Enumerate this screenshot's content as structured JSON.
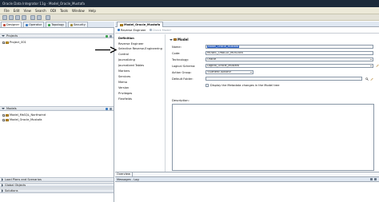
{
  "window": {
    "title": "Oracle Data Integrator 11g - Model_Oracle_Mustafa"
  },
  "menubar": {
    "items": [
      "File",
      "Edit",
      "View",
      "Search",
      "ODI",
      "Tools",
      "Window",
      "Help"
    ]
  },
  "left_tabs": [
    {
      "label": "Designer",
      "active": true
    },
    {
      "label": "Operator",
      "active": false
    },
    {
      "label": "Topology",
      "active": false
    },
    {
      "label": "Security",
      "active": false
    }
  ],
  "projects": {
    "title": "Projects",
    "items": [
      "Project_001"
    ]
  },
  "models": {
    "title": "Models",
    "items": [
      "Model_MsSQL_Northwind",
      "Model_Oracle_Mustafa"
    ]
  },
  "bottom_sections": [
    "Load Plans and Scenarios",
    "Global Objects",
    "Solutions"
  ],
  "editor": {
    "tab_label": "Model_Oracle_Mustafa",
    "toolbar": {
      "reverse": "Reverse Engineer",
      "check_model": "Check Model"
    },
    "nav_items": [
      "Definition",
      "Reverse Engineer",
      "Selective Reverse-Engineering",
      "Control",
      "Journalizing",
      "Journalized Tables",
      "Markers",
      "Services",
      "Memo",
      "Version",
      "Privileges",
      "Flexfields"
    ],
    "nav_selected": 0,
    "section_title": "Model",
    "fields": {
      "name_label": "Name:",
      "name_value": "Model_Oracle_Mustafa",
      "code_label": "Code:",
      "code_value": "MODEL_ORACLE_MUSTAFA",
      "technology_label": "Technology:",
      "technology_value": "Oracle",
      "logical_schema_label": "Logical Schema:",
      "logical_schema_value": "Logical_Oracle_Mustafa",
      "action_group_label": "Action Group:",
      "action_group_value": "<Generic Action>",
      "default_folder_label": "Default Folder:",
      "default_folder_value": "",
      "display_metadata_label": "Display the Metadata changes in the Model tree",
      "description_label": "Description:"
    },
    "overview_tab": "Overview",
    "messages_title": "Messages - Log"
  },
  "colors": {
    "titlebar": "#1c2a3a",
    "selection": "#2d62c5",
    "model_folder": "#c98c2f"
  }
}
